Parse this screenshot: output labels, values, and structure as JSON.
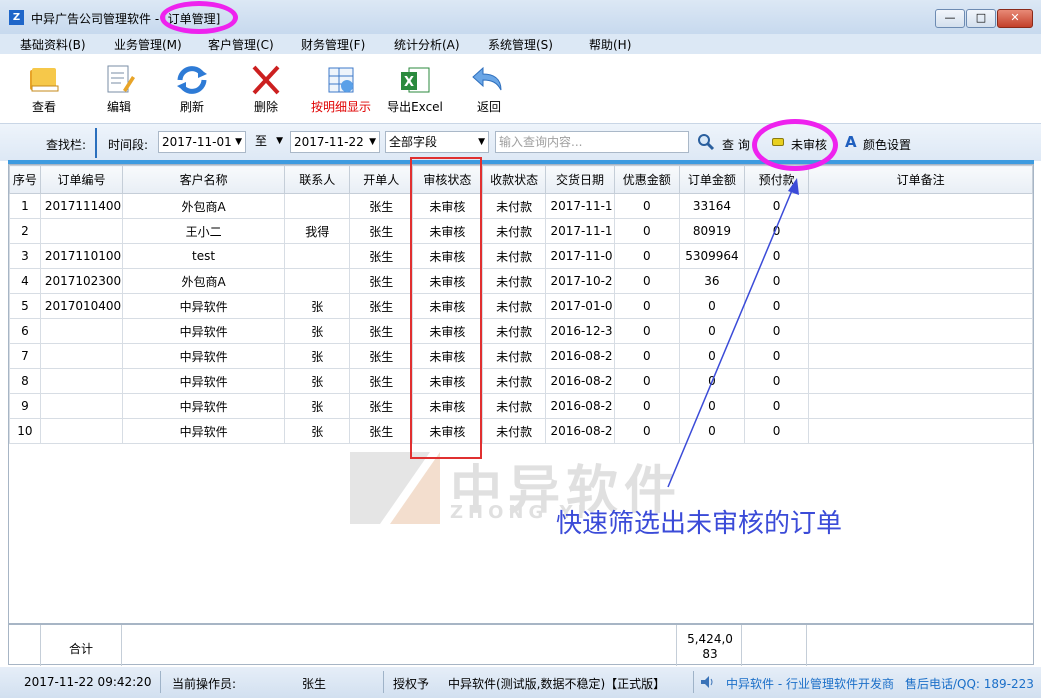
{
  "window": {
    "title_prefix": "中异广告公司管理软件 - ",
    "title_module": "[订单管理]",
    "min": "—",
    "max": "□",
    "close": "✕",
    "app_icon": "Z"
  },
  "menu": [
    "基础资料(B)",
    "业务管理(M)",
    "客户管理(C)",
    "财务管理(F)",
    "统计分析(A)",
    "系统管理(S)",
    "帮助(H)"
  ],
  "toolbar": {
    "view": "查看",
    "edit": "编辑",
    "refresh": "刷新",
    "delete": "删除",
    "detail": "按明细显示",
    "export": "导出Excel",
    "back": "返回"
  },
  "search": {
    "bar_label": "查找栏:",
    "period_label": "时间段:",
    "date_from": "2017-11-01",
    "to_label": "至",
    "date_to": "2017-11-22",
    "field": "全部字段",
    "placeholder": "输入查询内容...",
    "query_label": "查 询",
    "unreviewed_label": "未审核",
    "color_label": "颜色设置"
  },
  "table": {
    "headers": [
      "序号",
      "订单编号",
      "客户名称",
      "联系人",
      "开单人",
      "审核状态",
      "收款状态",
      "交货日期",
      "优惠金额",
      "订单金额",
      "预付款",
      "订单备注"
    ],
    "rows": [
      [
        "1",
        "2017111400",
        "外包商A",
        "",
        "张生",
        "未审核",
        "未付款",
        "2017-11-1",
        "0",
        "33164",
        "0",
        ""
      ],
      [
        "2",
        "",
        "王小二",
        "我得",
        "张生",
        "未审核",
        "未付款",
        "2017-11-1",
        "0",
        "80919",
        "0",
        ""
      ],
      [
        "3",
        "2017110100",
        "test",
        "",
        "张生",
        "未审核",
        "未付款",
        "2017-11-0",
        "0",
        "5309964",
        "0",
        ""
      ],
      [
        "4",
        "2017102300",
        "外包商A",
        "",
        "张生",
        "未审核",
        "未付款",
        "2017-10-2",
        "0",
        "36",
        "0",
        ""
      ],
      [
        "5",
        "2017010400",
        "中异软件",
        "张",
        "张生",
        "未审核",
        "未付款",
        "2017-01-0",
        "0",
        "0",
        "0",
        ""
      ],
      [
        "6",
        "",
        "中异软件",
        "张",
        "张生",
        "未审核",
        "未付款",
        "2016-12-3",
        "0",
        "0",
        "0",
        ""
      ],
      [
        "7",
        "",
        "中异软件",
        "张",
        "张生",
        "未审核",
        "未付款",
        "2016-08-2",
        "0",
        "0",
        "0",
        ""
      ],
      [
        "8",
        "",
        "中异软件",
        "张",
        "张生",
        "未审核",
        "未付款",
        "2016-08-2",
        "0",
        "0",
        "0",
        ""
      ],
      [
        "9",
        "",
        "中异软件",
        "张",
        "张生",
        "未审核",
        "未付款",
        "2016-08-2",
        "0",
        "0",
        "0",
        ""
      ],
      [
        "10",
        "",
        "中异软件",
        "张",
        "张生",
        "未审核",
        "未付款",
        "2016-08-2",
        "0",
        "0",
        "0",
        ""
      ]
    ]
  },
  "footer": {
    "total_label": "合计",
    "total_line1": "5,424,0",
    "total_line2": "83"
  },
  "status": {
    "datetime": "2017-11-22 09:42:20",
    "operator_label": "当前操作员:",
    "operator": "张生",
    "auth_label": "授权予",
    "license": "中异软件(测试版,数据不稳定)【正式版】",
    "vendor": "中异软件 - 行业管理软件开发商",
    "support": "售后电话/QQ: 189-223"
  },
  "watermark": {
    "cn": "中异软件",
    "en": "ZHONG YI"
  },
  "annotation": "快速筛选出未审核的订单",
  "colors": {
    "annotation": "#3b4bd8",
    "highlight_circle": "#ee22ee",
    "red_box": "#e03030",
    "accent": "#3d9be0"
  }
}
